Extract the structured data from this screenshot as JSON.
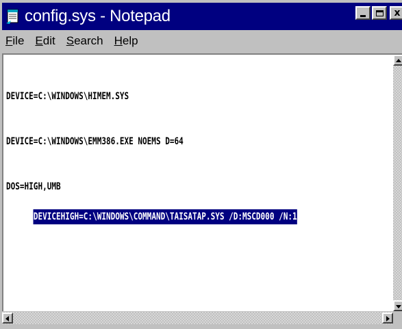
{
  "window": {
    "title": "config.sys - Notepad",
    "title_bar_color": "#000080",
    "icon": "notepad-icon"
  },
  "caption_buttons": {
    "minimize_icon": "minimize-icon",
    "maximize_icon": "maximize-icon",
    "close_label": "x"
  },
  "menu": {
    "items": [
      {
        "accel": "F",
        "rest": "ile"
      },
      {
        "accel": "E",
        "rest": "dit"
      },
      {
        "accel": "S",
        "rest": "earch"
      },
      {
        "accel": "H",
        "rest": "elp"
      }
    ]
  },
  "document": {
    "lines": [
      "DEVICE=C:\\WINDOWS\\HIMEM.SYS",
      "DEVICE=C:\\WINDOWS\\EMM386.EXE NOEMS D=64",
      "DOS=HIGH,UMB",
      "DEVICEHIGH=C:\\WINDOWS\\COMMAND\\TAISATAP.SYS /D:MSCD000 /N:1"
    ],
    "selected_line_index": 3,
    "selection_color": "#000080"
  },
  "scrollbars": {
    "up_icon": "scroll-up-arrow-icon",
    "down_icon": "scroll-down-arrow-icon",
    "left_icon": "scroll-left-arrow-icon",
    "right_icon": "scroll-right-arrow-icon"
  }
}
